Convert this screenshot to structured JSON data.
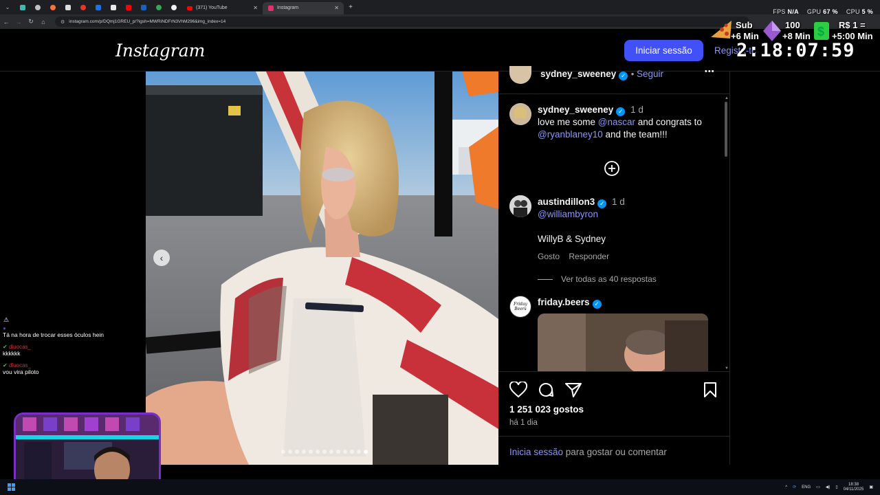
{
  "browser": {
    "tabs": [
      {
        "label": "(371) YouTube",
        "favicon_color": "#ff0000"
      },
      {
        "label": "Instagram",
        "favicon_color": "#e1306c",
        "active": true
      }
    ],
    "new_tab_label": "+",
    "url": "instagram.com/p/DQmj1GREU_p/?igsh=MWRiNDFrN3VhM296&img_index=14"
  },
  "overlay": {
    "stats": [
      {
        "label": "FPS",
        "value": "N/A"
      },
      {
        "label": "GPU",
        "value": "67 %"
      },
      {
        "label": "CPU",
        "value": "5 %"
      }
    ],
    "badges": {
      "sub_label": "Sub",
      "sub_time": "+6 Min",
      "gem_count": "100",
      "gem_time": "+8 Min",
      "money_label": "R$ 1 =",
      "money_time": "+5:00 Min"
    },
    "timer": "2:18:07:59"
  },
  "ig": {
    "logo": "Instagram",
    "login_button": "Iniciar sessão",
    "register_link": "Regista-te",
    "post": {
      "author": "sydney_sweeney",
      "follow": "Seguir",
      "more_label": "•••",
      "caption_user": "sydney_sweeney",
      "caption_time": "1 d",
      "caption_line1_a": "love me some ",
      "caption_mention1": "@nascar",
      "caption_line1_b": " and congrats to",
      "caption_mention2": "@ryanblaney10",
      "caption_line2_b": " and the team!!!",
      "comments": [
        {
          "user": "austindillon3",
          "time": "1 d",
          "mention": "@williambyron",
          "text": "WillyB & Sydney",
          "like_label": "Gosto",
          "reply_label": "Responder",
          "view_replies": "Ver todas as 40 respostas"
        },
        {
          "user": "friday.beers",
          "avatar_text": "Friday Beers"
        }
      ],
      "likes": "1 251 023 gostos",
      "posted": "há 1 dia",
      "login_prompt_link": "Inicia sessão",
      "login_prompt_rest": " para gostar ou comentar",
      "carousel": {
        "total": 13,
        "active_index": 13
      }
    }
  },
  "chat": [
    {
      "name": "",
      "text": "Tá na hora de trocar esses óculos hein"
    },
    {
      "name": "dluocas_",
      "text": "kkkkkk"
    },
    {
      "name": "dluocas_",
      "text": "vou vira piloto"
    }
  ],
  "taskbar": {
    "lang": "ENG",
    "time": "18:38",
    "date": "04/11/2025"
  }
}
